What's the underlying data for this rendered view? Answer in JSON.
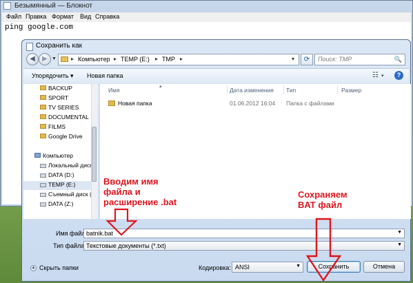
{
  "notepad": {
    "title": "Безымянный — Блокнот",
    "menu": [
      "Файл",
      "Правка",
      "Формат",
      "Вид",
      "Справка"
    ],
    "content": "ping google.com"
  },
  "dialog": {
    "title": "Сохранить как",
    "breadcrumbs": [
      "Компьютер",
      "TEMP (E:)",
      "TMP"
    ],
    "search_placeholder": "Поиск: TMP",
    "toolbar": {
      "organize": "Упорядочить ▾",
      "new_folder": "Новая папка"
    },
    "nav_items": [
      {
        "label": "BACKUP",
        "icon": "folder-icon"
      },
      {
        "label": "SPORT",
        "icon": "folder-icon"
      },
      {
        "label": "TV SERIES",
        "icon": "folder-icon"
      },
      {
        "label": "DOCUMENTAL",
        "icon": "folder-icon"
      },
      {
        "label": "FILMS",
        "icon": "folder-icon"
      },
      {
        "label": "Google Drive",
        "icon": "folder-icon"
      },
      {
        "label": "Компьютер",
        "icon": "computer-icon"
      },
      {
        "label": "Локальный диск",
        "icon": "drive-icon"
      },
      {
        "label": "DATA (D:)",
        "icon": "drive-icon"
      },
      {
        "label": "TEMP (E:)",
        "icon": "drive-icon"
      },
      {
        "label": "Съемный диск (",
        "icon": "drive-icon"
      },
      {
        "label": "DATA (Z:)",
        "icon": "drive-icon"
      }
    ],
    "columns": {
      "name": "Имя",
      "date": "Дата изменения",
      "type": "Тип",
      "size": "Размер"
    },
    "files": [
      {
        "name": "Новая папка",
        "date": "01.06.2012 16:04",
        "type": "Папка с файлами",
        "size": ""
      }
    ],
    "filename_label": "Имя файла:",
    "filename_value": "batnik.bat",
    "filetype_label": "Тип файла:",
    "filetype_value": "Текстовые документы (*.txt)",
    "hide_folders": "Скрыть папки",
    "encoding_label": "Кодировка:",
    "encoding_value": "ANSI",
    "save_button": "Сохранить",
    "cancel_button": "Отмена"
  },
  "annotations": {
    "left": [
      "Вводим имя",
      "файла и",
      "расширение .bat"
    ],
    "right": [
      "Сохраняем",
      "BAT файл"
    ],
    "color": "#e0151d"
  }
}
